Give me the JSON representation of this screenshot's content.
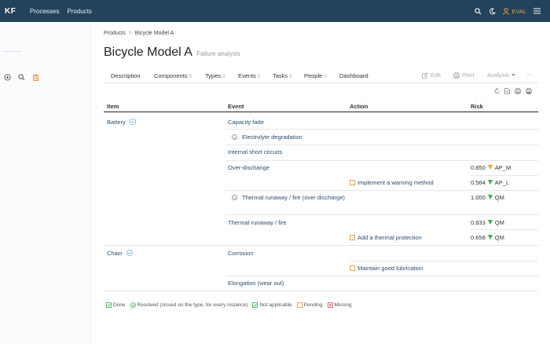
{
  "topbar": {
    "logo": "KF",
    "nav": [
      "Processes",
      "Products"
    ],
    "user": "EVAL",
    "icons": [
      "search-icon",
      "moon-icon",
      "user-icon",
      "menu-icon"
    ],
    "bg_color": "#23425c",
    "user_color": "#f39c32"
  },
  "breadcrumb": [
    "Products",
    "Bicycle Model A"
  ],
  "page": {
    "title": "Bicycle Model A",
    "subtitle": "Failure analysis"
  },
  "tabs": {
    "description": "Description",
    "components": "Components",
    "components_count": "9",
    "types": "Types",
    "types_count": "0",
    "events": "Events",
    "events_count": "0",
    "tasks": "Tasks",
    "tasks_count": "0",
    "people": "People",
    "people_count": "0",
    "dashboard": "Dashboard",
    "edit": "Edit",
    "print": "Print",
    "analysis": "Analysis",
    "more": "···"
  },
  "table": {
    "headers": {
      "item": "Item",
      "event": "Event",
      "action": "Action",
      "risk": "Risk"
    },
    "items": [
      "Battery",
      "Chain"
    ],
    "events": [
      "Capacity fade",
      "Electrolyte degradation",
      "Internal short circuits",
      "Over-dischange",
      "Thermal runaway / fire (over discharge)",
      "Thermal runaway / fire",
      "Corrosion",
      "Elongation (wear out)"
    ],
    "actions": [
      "Implement a warning method",
      "Add a thermal protection",
      "Maintain good lubrication"
    ],
    "risks": [
      {
        "value": "0.850",
        "label": "AP_M",
        "color": "#f5a623"
      },
      {
        "value": "0.564",
        "label": "AP_L",
        "color": "#2fb34a"
      },
      {
        "value": "1.000",
        "label": "QM",
        "color": "#2fb34a"
      },
      {
        "value": "0.833",
        "label": "QM",
        "color": "#2fb34a"
      },
      {
        "value": "0.658",
        "label": "QM",
        "color": "#2fb34a"
      }
    ]
  },
  "legend": {
    "done": "Done",
    "resolved": "Resolved (closed on the type, for every instance)",
    "not_applicable": "Not applicable",
    "pending": "Pending",
    "missing": "Missing"
  }
}
